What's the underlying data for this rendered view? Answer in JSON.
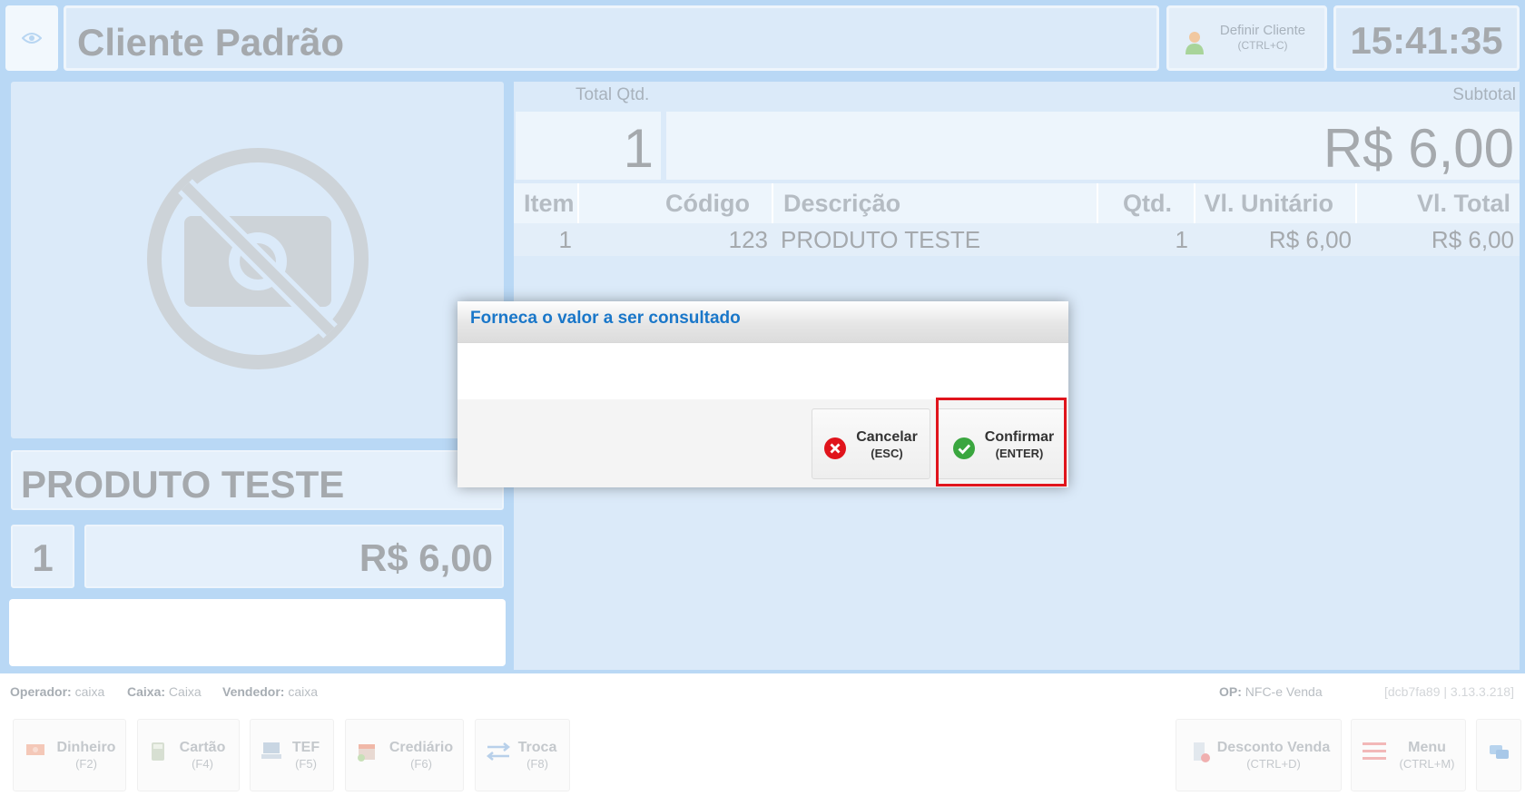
{
  "header": {
    "client_name": "Cliente Padrão",
    "define_client_label": "Definir Cliente",
    "define_client_shortcut": "(CTRL+C)",
    "clock": "15:41:35"
  },
  "product": {
    "name": "PRODUTO TESTE",
    "quantity": "1",
    "price": "R$ 6,00"
  },
  "totals": {
    "total_qtd_label": "Total Qtd.",
    "total_qtd": "1",
    "subtotal_label": "Subtotal",
    "subtotal": "R$ 6,00"
  },
  "grid": {
    "columns": [
      "Item",
      "Código",
      "Descrição",
      "Qtd.",
      "Vl. Unitário",
      "Vl. Total"
    ],
    "rows": [
      [
        "1",
        "123",
        "PRODUTO TESTE",
        "1",
        "R$ 6,00",
        "R$ 6,00"
      ]
    ]
  },
  "status": {
    "operador_label": "Operador:",
    "operador": "caixa",
    "caixa_label": "Caixa:",
    "caixa": "Caixa",
    "vendedor_label": "Vendedor:",
    "vendedor": "caixa",
    "op_label": "OP:",
    "op": "NFC-e Venda",
    "version": "[dcb7fa89 | 3.13.3.218]"
  },
  "toolbar": {
    "dinheiro": {
      "label": "Dinheiro",
      "key": "(F2)"
    },
    "cartao": {
      "label": "Cartão",
      "key": "(F4)"
    },
    "tef": {
      "label": "TEF",
      "key": "(F5)"
    },
    "crediario": {
      "label": "Crediário",
      "key": "(F6)"
    },
    "troca": {
      "label": "Troca",
      "key": "(F8)"
    },
    "desconto": {
      "label": "Desconto Venda",
      "key": "(CTRL+D)"
    },
    "menu": {
      "label": "Menu",
      "key": "(CTRL+M)"
    }
  },
  "dialog": {
    "title": "Forneca o valor a ser consultado",
    "input_value": "",
    "cancel_label": "Cancelar",
    "cancel_key": "(ESC)",
    "confirm_label": "Confirmar",
    "confirm_key": "(ENTER)"
  },
  "colors": {
    "background": "#b9d8f5",
    "panel": "#dbeaf9",
    "dialog_title": "#1a77c9",
    "highlight": "#e0141c",
    "cancel_icon": "#e0141c",
    "confirm_icon": "#3aa63f"
  }
}
